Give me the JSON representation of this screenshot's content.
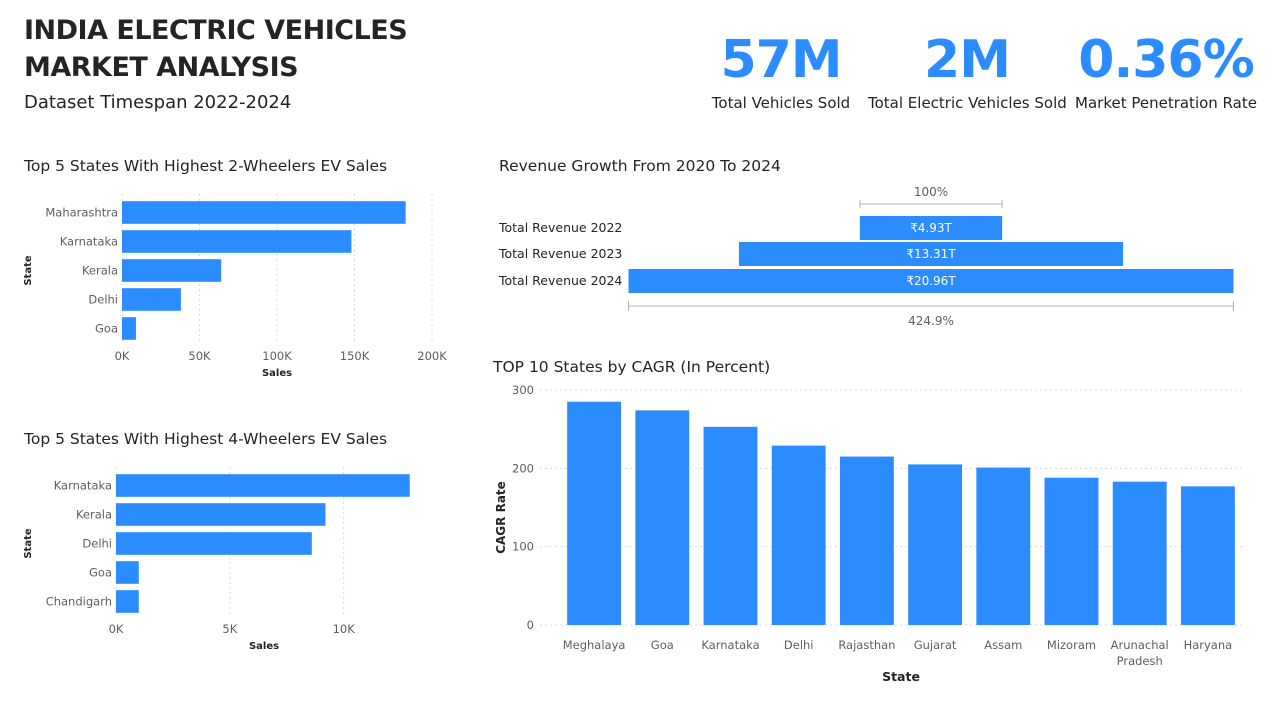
{
  "header": {
    "title_line1": "INDIA ELECTRIC VEHICLES",
    "title_line2": "MARKET ANALYSIS",
    "subtitle": "Dataset Timespan 2022-2024"
  },
  "kpis": [
    {
      "value": "57M",
      "label": "Total Vehicles Sold"
    },
    {
      "value": "2M",
      "label": "Total Electric Vehicles Sold"
    },
    {
      "value": "0.36%",
      "label": "Market Penetration Rate"
    }
  ],
  "colors": {
    "bar": "#2b8cff",
    "text": "#252423",
    "axis": "#605e5c"
  },
  "chart_data": [
    {
      "id": "two_wheelers",
      "type": "bar",
      "orientation": "horizontal",
      "title": "Top 5 States With Highest 2-Wheelers EV Sales",
      "categories": [
        "Maharashtra",
        "Karnataka",
        "Kerala",
        "Delhi",
        "Goa"
      ],
      "values": [
        183000,
        148000,
        64000,
        38000,
        9000
      ],
      "xlabel": "Sales",
      "ylabel": "State",
      "xlim": [
        0,
        200000
      ],
      "ticks": [
        0,
        50000,
        100000,
        150000,
        200000
      ],
      "tick_labels": [
        "0K",
        "50K",
        "100K",
        "150K",
        "200K"
      ],
      "grid": true
    },
    {
      "id": "four_wheelers",
      "type": "bar",
      "orientation": "horizontal",
      "title": "Top 5 States With Highest 4-Wheelers EV Sales",
      "categories": [
        "Karnataka",
        "Kerala",
        "Delhi",
        "Goa",
        "Chandigarh"
      ],
      "values": [
        12900,
        9200,
        8600,
        1000,
        1000
      ],
      "xlabel": "Sales",
      "ylabel": "State",
      "xlim": [
        0,
        13000
      ],
      "ticks": [
        0,
        5000,
        10000
      ],
      "tick_labels": [
        "0K",
        "5K",
        "10K"
      ],
      "grid": true
    },
    {
      "id": "revenue",
      "type": "bar",
      "subtype": "funnel",
      "title": "Revenue Growth From 2020 To 2024",
      "categories": [
        "Total Revenue 2022",
        "Total Revenue 2023",
        "Total Revenue 2024"
      ],
      "values": [
        4.93,
        13.31,
        20.96
      ],
      "value_labels": [
        "₹4.93T",
        "₹13.31T",
        "₹20.96T"
      ],
      "top_label": "100%",
      "bottom_label": "424.9%"
    },
    {
      "id": "cagr",
      "type": "bar",
      "title": "TOP 10 States by CAGR (In Percent)",
      "categories": [
        "Meghalaya",
        "Goa",
        "Karnataka",
        "Delhi",
        "Rajasthan",
        "Gujarat",
        "Assam",
        "Mizoram",
        "Arunachal Pradesh",
        "Haryana"
      ],
      "values": [
        285,
        274,
        253,
        229,
        215,
        205,
        201,
        188,
        183,
        177
      ],
      "xlabel": "State",
      "ylabel": "CAGR Rate",
      "ylim": [
        0,
        300
      ],
      "ticks": [
        0,
        100,
        200,
        300
      ],
      "grid": true
    }
  ]
}
